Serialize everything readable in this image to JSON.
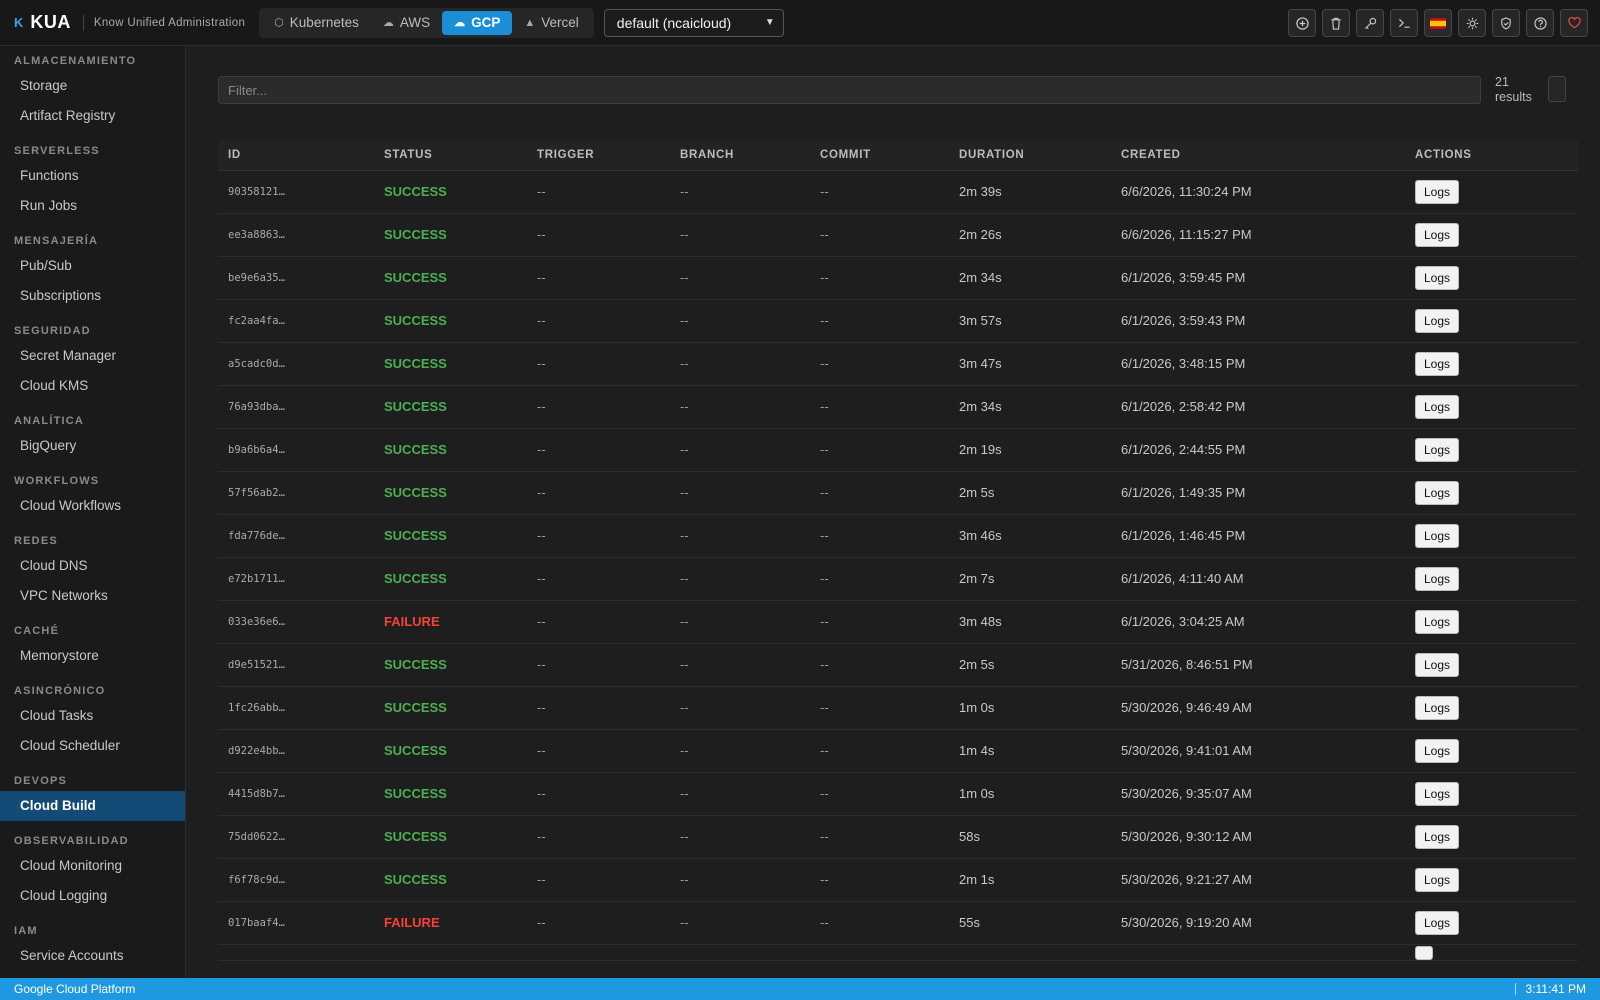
{
  "brand": {
    "mark": "K",
    "name": "KUA",
    "tagline": "Know Unified Administration"
  },
  "providers": [
    {
      "label": "Kubernetes",
      "icon": "kubernetes-icon",
      "active": false
    },
    {
      "label": "AWS",
      "icon": "cloud-icon",
      "active": false
    },
    {
      "label": "GCP",
      "icon": "gcp-cloud-icon",
      "active": true
    },
    {
      "label": "Vercel",
      "icon": "triangle-icon",
      "active": false
    }
  ],
  "context_select": {
    "value": "default (ncaicloud)"
  },
  "toolbar": [
    "add-icon",
    "trash-icon",
    "key-icon",
    "terminal-icon",
    "spain-flag-icon",
    "sun-icon",
    "shield-icon",
    "help-icon",
    "heart-icon"
  ],
  "sidebar": [
    {
      "section": "ALMACENAMIENTO",
      "items": [
        "Storage",
        "Artifact Registry"
      ]
    },
    {
      "section": "SERVERLESS",
      "items": [
        "Functions",
        "Run Jobs"
      ]
    },
    {
      "section": "MENSAJERÍA",
      "items": [
        "Pub/Sub",
        "Subscriptions"
      ]
    },
    {
      "section": "SEGURIDAD",
      "items": [
        "Secret Manager",
        "Cloud KMS"
      ]
    },
    {
      "section": "ANALÍTICA",
      "items": [
        "BigQuery"
      ]
    },
    {
      "section": "WORKFLOWS",
      "items": [
        "Cloud Workflows"
      ]
    },
    {
      "section": "REDES",
      "items": [
        "Cloud DNS",
        "VPC Networks"
      ]
    },
    {
      "section": "CACHÉ",
      "items": [
        "Memorystore"
      ]
    },
    {
      "section": "ASINCRÓNICO",
      "items": [
        "Cloud Tasks",
        "Cloud Scheduler"
      ]
    },
    {
      "section": "DEVOPS",
      "items": [
        "Cloud Build"
      ]
    },
    {
      "section": "OBSERVABILIDAD",
      "items": [
        "Cloud Monitoring",
        "Cloud Logging"
      ]
    },
    {
      "section": "IAM",
      "items": [
        "Service Accounts"
      ]
    }
  ],
  "active_nav": "Cloud Build",
  "filter": {
    "placeholder": "Filter...",
    "value": ""
  },
  "results_count": "21",
  "results_label": "results",
  "table": {
    "columns": [
      "ID",
      "STATUS",
      "TRIGGER",
      "BRANCH",
      "COMMIT",
      "DURATION",
      "CREATED",
      "ACTIONS"
    ],
    "action_label": "Logs",
    "rows": [
      {
        "id": "90358121…",
        "status": "SUCCESS",
        "trigger": "--",
        "branch": "--",
        "commit": "--",
        "duration": "2m 39s",
        "created": "6/6/2026, 11:30:24 PM"
      },
      {
        "id": "ee3a8863…",
        "status": "SUCCESS",
        "trigger": "--",
        "branch": "--",
        "commit": "--",
        "duration": "2m 26s",
        "created": "6/6/2026, 11:15:27 PM"
      },
      {
        "id": "be9e6a35…",
        "status": "SUCCESS",
        "trigger": "--",
        "branch": "--",
        "commit": "--",
        "duration": "2m 34s",
        "created": "6/1/2026, 3:59:45 PM"
      },
      {
        "id": "fc2aa4fa…",
        "status": "SUCCESS",
        "trigger": "--",
        "branch": "--",
        "commit": "--",
        "duration": "3m 57s",
        "created": "6/1/2026, 3:59:43 PM"
      },
      {
        "id": "a5cadc0d…",
        "status": "SUCCESS",
        "trigger": "--",
        "branch": "--",
        "commit": "--",
        "duration": "3m 47s",
        "created": "6/1/2026, 3:48:15 PM"
      },
      {
        "id": "76a93dba…",
        "status": "SUCCESS",
        "trigger": "--",
        "branch": "--",
        "commit": "--",
        "duration": "2m 34s",
        "created": "6/1/2026, 2:58:42 PM"
      },
      {
        "id": "b9a6b6a4…",
        "status": "SUCCESS",
        "trigger": "--",
        "branch": "--",
        "commit": "--",
        "duration": "2m 19s",
        "created": "6/1/2026, 2:44:55 PM"
      },
      {
        "id": "57f56ab2…",
        "status": "SUCCESS",
        "trigger": "--",
        "branch": "--",
        "commit": "--",
        "duration": "2m 5s",
        "created": "6/1/2026, 1:49:35 PM"
      },
      {
        "id": "fda776de…",
        "status": "SUCCESS",
        "trigger": "--",
        "branch": "--",
        "commit": "--",
        "duration": "3m 46s",
        "created": "6/1/2026, 1:46:45 PM"
      },
      {
        "id": "e72b1711…",
        "status": "SUCCESS",
        "trigger": "--",
        "branch": "--",
        "commit": "--",
        "duration": "2m 7s",
        "created": "6/1/2026, 4:11:40 AM"
      },
      {
        "id": "033e36e6…",
        "status": "FAILURE",
        "trigger": "--",
        "branch": "--",
        "commit": "--",
        "duration": "3m 48s",
        "created": "6/1/2026, 3:04:25 AM"
      },
      {
        "id": "d9e51521…",
        "status": "SUCCESS",
        "trigger": "--",
        "branch": "--",
        "commit": "--",
        "duration": "2m 5s",
        "created": "5/31/2026, 8:46:51 PM"
      },
      {
        "id": "1fc26abb…",
        "status": "SUCCESS",
        "trigger": "--",
        "branch": "--",
        "commit": "--",
        "duration": "1m 0s",
        "created": "5/30/2026, 9:46:49 AM"
      },
      {
        "id": "d922e4bb…",
        "status": "SUCCESS",
        "trigger": "--",
        "branch": "--",
        "commit": "--",
        "duration": "1m 4s",
        "created": "5/30/2026, 9:41:01 AM"
      },
      {
        "id": "4415d8b7…",
        "status": "SUCCESS",
        "trigger": "--",
        "branch": "--",
        "commit": "--",
        "duration": "1m 0s",
        "created": "5/30/2026, 9:35:07 AM"
      },
      {
        "id": "75dd0622…",
        "status": "SUCCESS",
        "trigger": "--",
        "branch": "--",
        "commit": "--",
        "duration": "58s",
        "created": "5/30/2026, 9:30:12 AM"
      },
      {
        "id": "f6f78c9d…",
        "status": "SUCCESS",
        "trigger": "--",
        "branch": "--",
        "commit": "--",
        "duration": "2m 1s",
        "created": "5/30/2026, 9:21:27 AM"
      },
      {
        "id": "017baaf4…",
        "status": "FAILURE",
        "trigger": "--",
        "branch": "--",
        "commit": "--",
        "duration": "55s",
        "created": "5/30/2026, 9:19:20 AM"
      }
    ]
  },
  "statusbar": {
    "left": "Google Cloud Platform",
    "clock": "3:11:41 PM"
  },
  "colors": {
    "accent": "#1a8fd8",
    "success": "#4caf50",
    "failure": "#f44336",
    "nav_active": "#134a76",
    "statusbar": "#1e98e0"
  }
}
